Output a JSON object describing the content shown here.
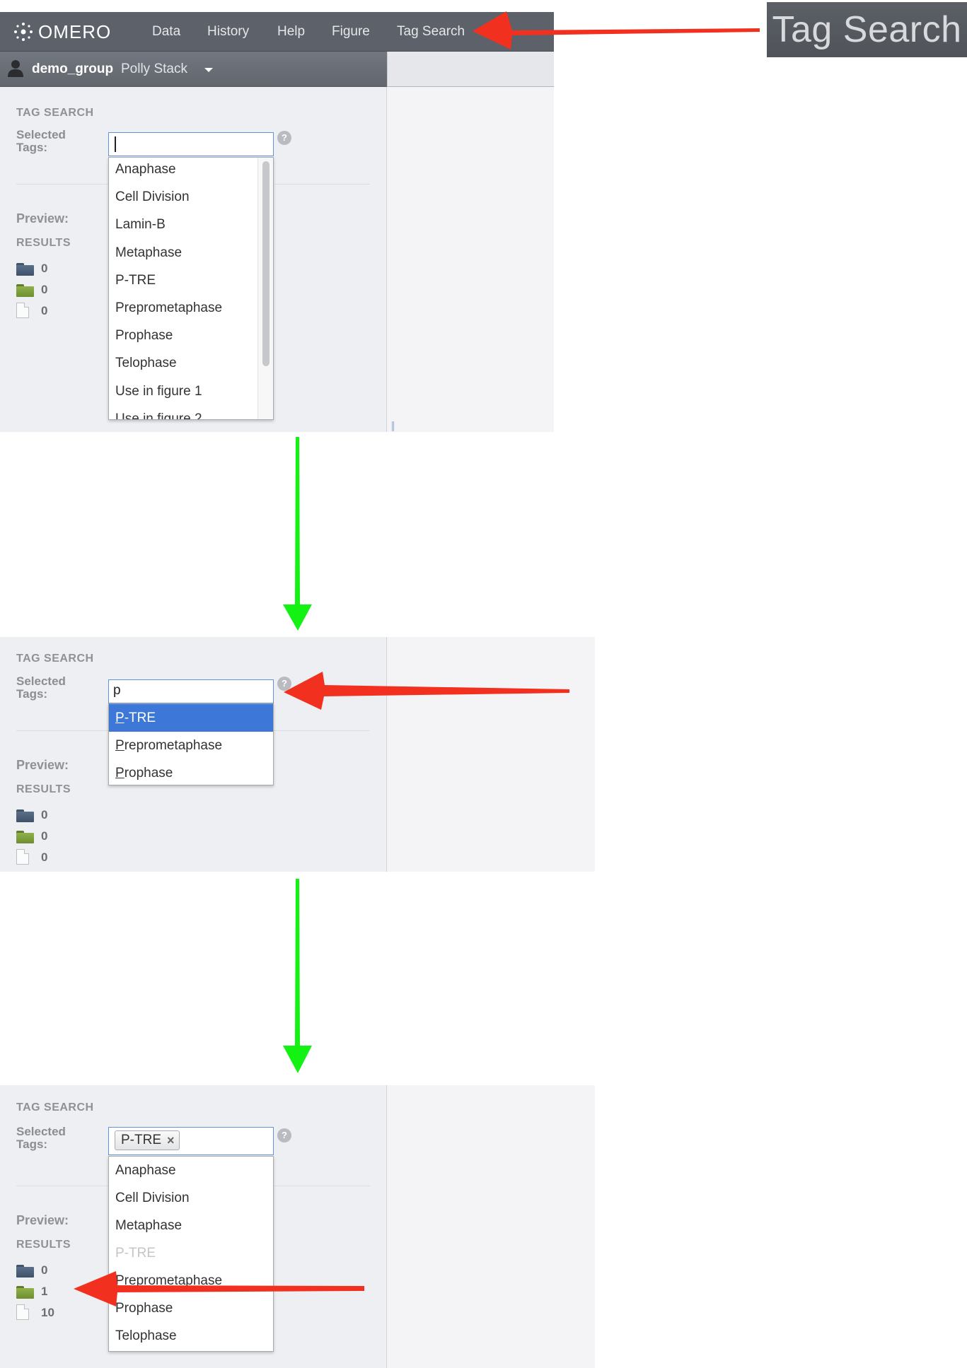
{
  "app": {
    "logo_text": "OMERO",
    "nav": [
      "Data",
      "History",
      "Help",
      "Figure",
      "Tag Search"
    ]
  },
  "groupbar": {
    "group": "demo_group",
    "user": "Polly Stack"
  },
  "zoom_callout": "Tag Search",
  "labels": {
    "heading": "TAG SEARCH",
    "selected_tags": "Selected Tags:",
    "help": "?",
    "preview": "Preview:",
    "results": "RESULTS"
  },
  "panel1": {
    "input_value": "",
    "dropdown": [
      "Anaphase",
      "Cell Division",
      "Lamin-B",
      "Metaphase",
      "P-TRE",
      "Preprometaphase",
      "Prophase",
      "Telophase",
      "Use in figure 1",
      "Use in figure 2"
    ],
    "results": {
      "projects": "0",
      "datasets": "0",
      "images": "0"
    }
  },
  "panel2": {
    "input_value": "p",
    "dropdown": [
      {
        "first": "P",
        "rest": "-TRE",
        "active": true
      },
      {
        "first": "P",
        "rest": "reprometaphase",
        "active": false
      },
      {
        "first": "P",
        "rest": "rophase",
        "active": false
      }
    ],
    "results": {
      "projects": "0",
      "datasets": "0",
      "images": "0"
    }
  },
  "panel3": {
    "chip": "P-TRE",
    "chip_remove": "×",
    "dropdown": [
      {
        "label": "Anaphase",
        "disabled": false
      },
      {
        "label": "Cell Division",
        "disabled": false
      },
      {
        "label": "Metaphase",
        "disabled": false
      },
      {
        "label": "P-TRE",
        "disabled": true
      },
      {
        "label": "Preprometaphase",
        "disabled": false
      },
      {
        "label": "Prophase",
        "disabled": false
      },
      {
        "label": "Telophase",
        "disabled": false
      }
    ],
    "results": {
      "projects": "0",
      "datasets": "1",
      "images": "10"
    }
  },
  "colors": {
    "arrow_red": "#f2301f",
    "arrow_green": "#13f213",
    "active_blue": "#3d78d8",
    "topbar": "#5d6169"
  }
}
